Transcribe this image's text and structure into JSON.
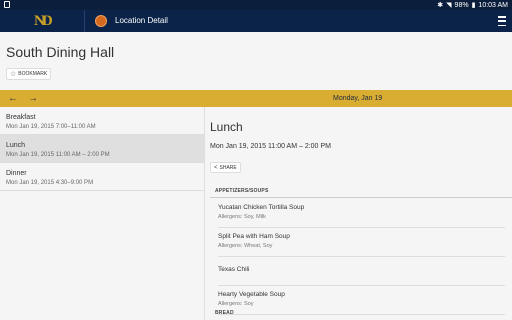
{
  "status": {
    "battery": "98%",
    "time": "10:03 AM"
  },
  "app_bar": {
    "logo": "ND",
    "title": "Location Detail"
  },
  "location": {
    "title": "South Dining Hall",
    "bookmark_label": "BOOKMARK"
  },
  "date_bar": {
    "date": "Monday, Jan 19"
  },
  "meals": [
    {
      "name": "Breakfast",
      "time": "Mon Jan 19, 2015 7:00–11:00 AM"
    },
    {
      "name": "Lunch",
      "time": "Mon Jan 19, 2015 11:00 AM – 2:00 PM"
    },
    {
      "name": "Dinner",
      "time": "Mon Jan 19, 2015 4:30–9:00 PM"
    }
  ],
  "detail": {
    "title": "Lunch",
    "time": "Mon Jan 19, 2015 11:00 AM – 2:00 PM",
    "share_label": "SHARE",
    "sections": [
      {
        "header": "APPETIZERS/SOUPS",
        "dishes": [
          {
            "name": "Yucatan Chicken Tortilla Soup",
            "allergens": "Allergens: Soy, Milk"
          },
          {
            "name": "Split Pea with Ham Soup",
            "allergens": "Allergens: Wheat, Soy"
          },
          {
            "name": "Texas Chili",
            "allergens": ""
          },
          {
            "name": "Hearty Vegetable Soup",
            "allergens": "Allergens: Soy"
          }
        ]
      },
      {
        "header": "BREAD",
        "dishes": []
      }
    ]
  },
  "colors": {
    "navy": "#0b2348",
    "gold": "#d9ad32"
  },
  "icons": {
    "back": "arrow-left-icon",
    "forward": "arrow-right-icon",
    "menu": "hamburger-icon",
    "bookmark": "star-icon",
    "share": "share-icon"
  }
}
